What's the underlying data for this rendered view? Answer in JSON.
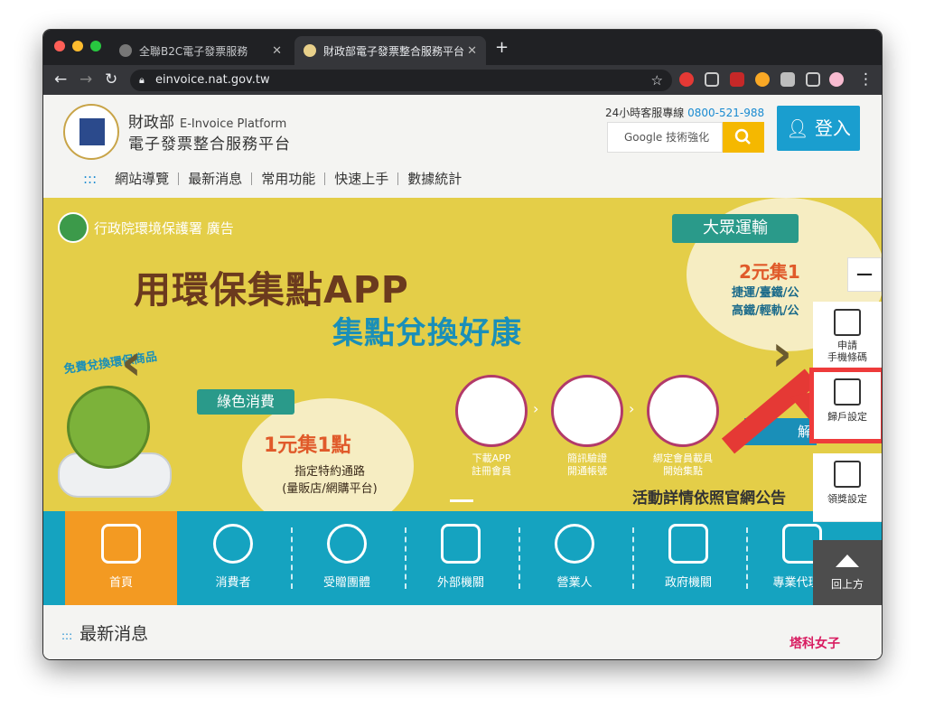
{
  "browser": {
    "tabs": [
      {
        "label": "全聯B2C電子發票服務",
        "close": "✕"
      },
      {
        "label": "財政部電子發票整合服務平台",
        "close": "✕"
      }
    ],
    "new_tab": "+",
    "url": "einvoice.nat.gov.tw"
  },
  "header": {
    "ministry": "財政部",
    "platform_en": "E-Invoice Platform",
    "platform_zh": "電子發票整合服務平台",
    "hotline_label": "24小時客服專線",
    "hotline_number": "0800-521-988",
    "search_placeholder": "Google 技術強化",
    "login": "登入"
  },
  "nav": {
    "prefix": ":::",
    "items": [
      "網站導覽",
      "最新消息",
      "常用功能",
      "快速上手",
      "數據統計"
    ]
  },
  "banner": {
    "sponsor": "行政院環境保護署 廣告",
    "headline1": "用環保集點APP",
    "headline2": "集點兌換好康",
    "free_exchange": "免費兌換環保商品",
    "green_title": "綠色消費",
    "green_points": "1元集1點",
    "green_desc": "指定特約通路\n(量販店/網購平台)",
    "steps": [
      "下載APP\n註冊會員",
      "簡訊驗證\n開通帳號",
      "綁定會員載具\n開始集點"
    ],
    "transport_title": "大眾運輸",
    "transport_points": "2元集1",
    "transport_desc": "捷運/臺鐵/公\n高鐵/輕軌/公",
    "learn_more": "解",
    "event_note": "活動詳情依照官網公告"
  },
  "categories": [
    "首頁",
    "消費者",
    "受贈團體",
    "外部機關",
    "營業人",
    "政府機關",
    "專業代理人"
  ],
  "sidebar": {
    "collapse": "−",
    "apply_barcode": "申請\n手機條碼",
    "account_settings": "歸戶設定",
    "prize_settings": "領獎設定",
    "back_to_top": "回上方"
  },
  "news": {
    "prefix": ":::",
    "title": "最新消息"
  },
  "watermark": "塔科女子"
}
